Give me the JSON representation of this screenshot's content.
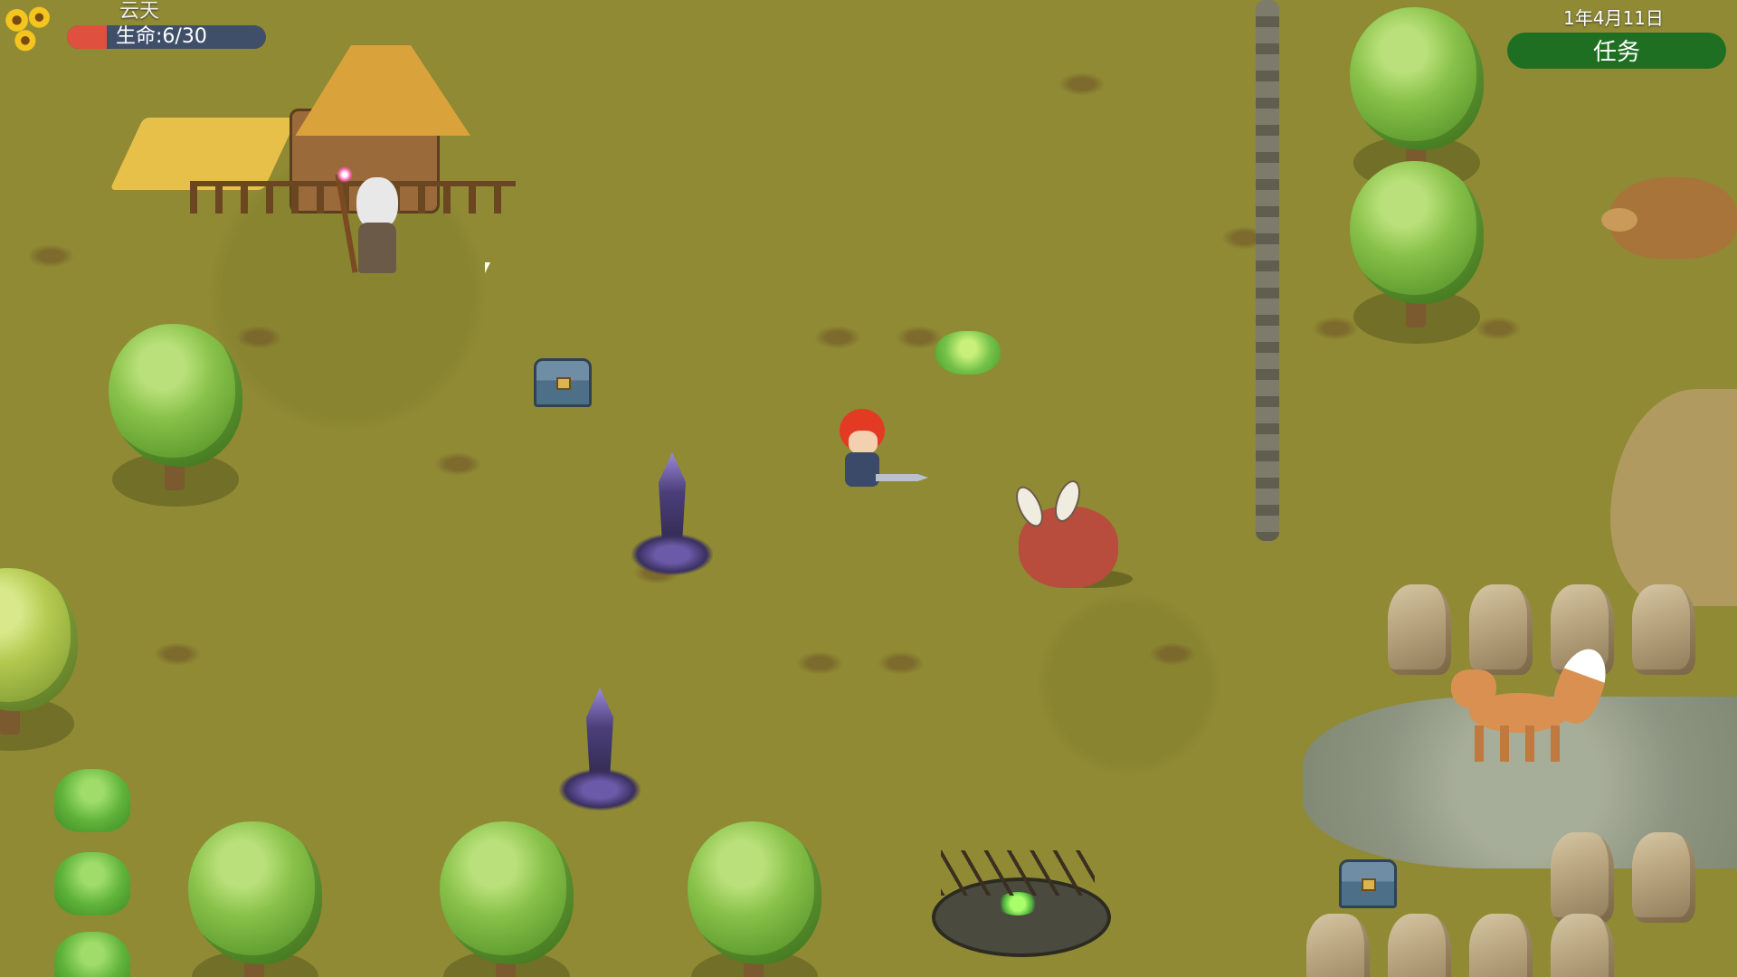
{
  "hud": {
    "player_name": "云天",
    "hp_label": "生命:6/30",
    "hp_current": 6,
    "hp_max": 30,
    "hp_color": "#e0503f"
  },
  "top_right": {
    "date": "1年4月11日",
    "task_button": "任务"
  },
  "colors": {
    "grass": "#8f8a33",
    "task_button_bg": "#1f6f22"
  },
  "icons": {
    "cursor": "mouse-cursor-icon"
  }
}
